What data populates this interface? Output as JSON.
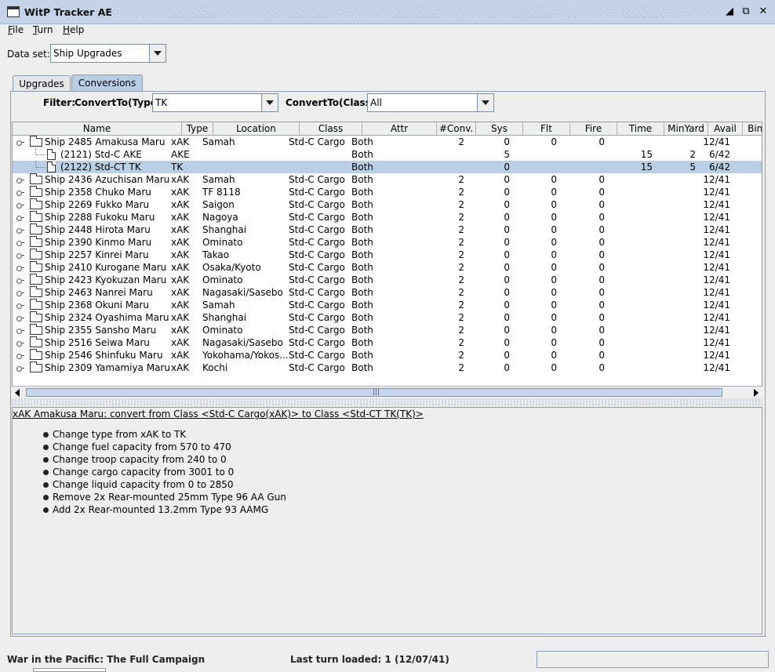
{
  "window": {
    "title": "WitP Tracker AE",
    "controls": [
      "minimize-icon",
      "maximize-icon",
      "close-icon"
    ]
  },
  "menu": {
    "items": [
      {
        "label": "File",
        "mnemonic": "F",
        "rest": "ile"
      },
      {
        "label": "Turn",
        "mnemonic": "T",
        "rest": "urn"
      },
      {
        "label": "Help",
        "mnemonic": "H",
        "rest": "elp"
      }
    ]
  },
  "dataset": {
    "label": "Data set:",
    "value": "Ship Upgrades"
  },
  "tabs": [
    {
      "label": "Upgrades",
      "active": false
    },
    {
      "label": "Conversions",
      "active": true
    }
  ],
  "filter": {
    "label": "Filter:",
    "type_label": "ConvertTo(Type):",
    "type_value": "TK",
    "class_label": "ConvertTo(Class):",
    "class_value": "All"
  },
  "table": {
    "columns": [
      "Name",
      "Type",
      "Location",
      "Class",
      "Attr",
      "#Conv.",
      "Sys",
      "Flt",
      "Fire",
      "Time",
      "MinYard",
      "Avail",
      "Bind"
    ],
    "rows": [
      {
        "kind": "parent",
        "expanded": true,
        "name": "Ship 2485 Amakusa Maru",
        "type": "xAK",
        "location": "Samah",
        "class": "Std-C Cargo",
        "attr": "Both",
        "conv": "2",
        "sys": "0",
        "flt": "0",
        "fire": "0",
        "time": "",
        "minyard": "",
        "avail": "12/41",
        "bind": ""
      },
      {
        "kind": "child",
        "name": "(2121) Std-C AKE",
        "type": "AKE",
        "location": "",
        "class": "",
        "attr": "Both",
        "conv": "",
        "sys": "5",
        "flt": "",
        "fire": "",
        "time": "15",
        "minyard": "2",
        "avail": "6/42",
        "bind": ""
      },
      {
        "kind": "child",
        "selected": true,
        "name": "(2122) Std-CT TK",
        "type": "TK",
        "location": "",
        "class": "",
        "attr": "Both",
        "conv": "",
        "sys": "0",
        "flt": "",
        "fire": "",
        "time": "15",
        "minyard": "5",
        "avail": "6/42",
        "bind": ""
      },
      {
        "kind": "parent",
        "name": "Ship 2436 Azuchisan Maru",
        "type": "xAK",
        "location": "Samah",
        "class": "Std-C Cargo",
        "attr": "Both",
        "conv": "2",
        "sys": "0",
        "flt": "0",
        "fire": "0",
        "time": "",
        "minyard": "",
        "avail": "12/41",
        "bind": ""
      },
      {
        "kind": "parent",
        "name": "Ship 2358 Chuko Maru",
        "type": "xAK",
        "location": "TF 8118",
        "class": "Std-C Cargo",
        "attr": "Both",
        "conv": "2",
        "sys": "0",
        "flt": "0",
        "fire": "0",
        "time": "",
        "minyard": "",
        "avail": "12/41",
        "bind": ""
      },
      {
        "kind": "parent",
        "name": "Ship 2269 Fukko Maru",
        "type": "xAK",
        "location": "Saigon",
        "class": "Std-C Cargo",
        "attr": "Both",
        "conv": "2",
        "sys": "0",
        "flt": "0",
        "fire": "0",
        "time": "",
        "minyard": "",
        "avail": "12/41",
        "bind": ""
      },
      {
        "kind": "parent",
        "name": "Ship 2288 Fukoku Maru",
        "type": "xAK",
        "location": "Nagoya",
        "class": "Std-C Cargo",
        "attr": "Both",
        "conv": "2",
        "sys": "0",
        "flt": "0",
        "fire": "0",
        "time": "",
        "minyard": "",
        "avail": "12/41",
        "bind": ""
      },
      {
        "kind": "parent",
        "name": "Ship 2448 Hirota Maru",
        "type": "xAK",
        "location": "Shanghai",
        "class": "Std-C Cargo",
        "attr": "Both",
        "conv": "2",
        "sys": "0",
        "flt": "0",
        "fire": "0",
        "time": "",
        "minyard": "",
        "avail": "12/41",
        "bind": ""
      },
      {
        "kind": "parent",
        "name": "Ship 2390 Kinmo Maru",
        "type": "xAK",
        "location": "Ominato",
        "class": "Std-C Cargo",
        "attr": "Both",
        "conv": "2",
        "sys": "0",
        "flt": "0",
        "fire": "0",
        "time": "",
        "minyard": "",
        "avail": "12/41",
        "bind": ""
      },
      {
        "kind": "parent",
        "name": "Ship 2257 Kinrei Maru",
        "type": "xAK",
        "location": "Takao",
        "class": "Std-C Cargo",
        "attr": "Both",
        "conv": "2",
        "sys": "0",
        "flt": "0",
        "fire": "0",
        "time": "",
        "minyard": "",
        "avail": "12/41",
        "bind": ""
      },
      {
        "kind": "parent",
        "name": "Ship 2410 Kurogane Maru",
        "type": "xAK",
        "location": "Osaka/Kyoto",
        "class": "Std-C Cargo",
        "attr": "Both",
        "conv": "2",
        "sys": "0",
        "flt": "0",
        "fire": "0",
        "time": "",
        "minyard": "",
        "avail": "12/41",
        "bind": ""
      },
      {
        "kind": "parent",
        "name": "Ship 2423 Kyokuzan Maru",
        "type": "xAK",
        "location": "Ominato",
        "class": "Std-C Cargo",
        "attr": "Both",
        "conv": "2",
        "sys": "0",
        "flt": "0",
        "fire": "0",
        "time": "",
        "minyard": "",
        "avail": "12/41",
        "bind": ""
      },
      {
        "kind": "parent",
        "name": "Ship 2463 Nanrei Maru",
        "type": "xAK",
        "location": "Nagasaki/Sasebo",
        "class": "Std-C Cargo",
        "attr": "Both",
        "conv": "2",
        "sys": "0",
        "flt": "0",
        "fire": "0",
        "time": "",
        "minyard": "",
        "avail": "12/41",
        "bind": ""
      },
      {
        "kind": "parent",
        "name": "Ship 2368 Okuni Maru",
        "type": "xAK",
        "location": "Samah",
        "class": "Std-C Cargo",
        "attr": "Both",
        "conv": "2",
        "sys": "0",
        "flt": "0",
        "fire": "0",
        "time": "",
        "minyard": "",
        "avail": "12/41",
        "bind": ""
      },
      {
        "kind": "parent",
        "name": "Ship 2324 Oyashima Maru",
        "type": "xAK",
        "location": "Shanghai",
        "class": "Std-C Cargo",
        "attr": "Both",
        "conv": "2",
        "sys": "0",
        "flt": "0",
        "fire": "0",
        "time": "",
        "minyard": "",
        "avail": "12/41",
        "bind": ""
      },
      {
        "kind": "parent",
        "name": "Ship 2355 Sansho Maru",
        "type": "xAK",
        "location": "Ominato",
        "class": "Std-C Cargo",
        "attr": "Both",
        "conv": "2",
        "sys": "0",
        "flt": "0",
        "fire": "0",
        "time": "",
        "minyard": "",
        "avail": "12/41",
        "bind": ""
      },
      {
        "kind": "parent",
        "name": "Ship 2516 Seiwa Maru",
        "type": "xAK",
        "location": "Nagasaki/Sasebo",
        "class": "Std-C Cargo",
        "attr": "Both",
        "conv": "2",
        "sys": "0",
        "flt": "0",
        "fire": "0",
        "time": "",
        "minyard": "",
        "avail": "12/41",
        "bind": ""
      },
      {
        "kind": "parent",
        "name": "Ship 2546 Shinfuku Maru",
        "type": "xAK",
        "location": "Yokohama/Yokos...",
        "class": "Std-C Cargo",
        "attr": "Both",
        "conv": "2",
        "sys": "0",
        "flt": "0",
        "fire": "0",
        "time": "",
        "minyard": "",
        "avail": "12/41",
        "bind": ""
      },
      {
        "kind": "parent",
        "name": "Ship 2309 Yamamiya Maru",
        "type": "xAK",
        "location": "Kochi",
        "class": "Std-C Cargo",
        "attr": "Both",
        "conv": "2",
        "sys": "0",
        "flt": "0",
        "fire": "0",
        "time": "",
        "minyard": "",
        "avail": "12/41",
        "bind": ""
      }
    ]
  },
  "detail": {
    "heading": "xAK Amakusa Maru: convert from Class <Std-C Cargo(xAK)> to Class <Std-CT TK(TK)>",
    "items": [
      "Change type from xAK to TK",
      "Change fuel capacity from 570 to 470",
      "Change troop capacity from 240 to 0",
      "Change cargo capacity from 3001 to 0",
      "Change liquid capacity from 0 to 2850",
      "Remove 2x Rear-mounted 25mm Type 96 AA Gun",
      "Add 2x Rear-mounted 13.2mm Type 93 AAMG"
    ]
  },
  "status": {
    "left": "War in the Pacific: The Full Campaign",
    "middle": "Last turn loaded: 1 (12/07/41)",
    "right": ""
  }
}
